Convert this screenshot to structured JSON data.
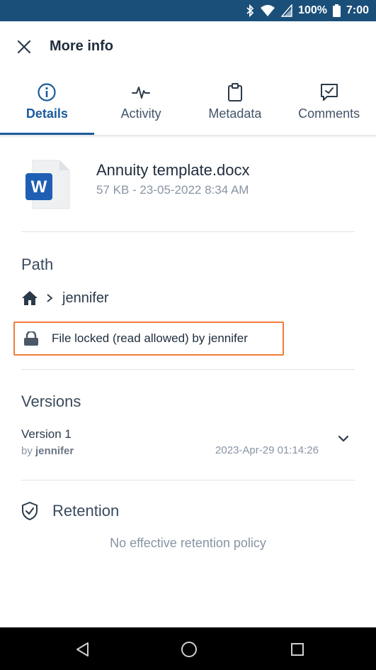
{
  "status_bar": {
    "battery": "100%",
    "time": "7:00"
  },
  "app_bar": {
    "title": "More info"
  },
  "tabs": [
    {
      "label": "Details",
      "icon": "info-icon",
      "active": true
    },
    {
      "label": "Activity",
      "icon": "activity-icon",
      "active": false
    },
    {
      "label": "Metadata",
      "icon": "clipboard-icon",
      "active": false
    },
    {
      "label": "Comments",
      "icon": "comment-check-icon",
      "active": false
    }
  ],
  "file": {
    "name": "Annuity template.docx",
    "meta": "57 KB - 23-05-2022 8:34 AM",
    "icon": "word-document-icon"
  },
  "path": {
    "title": "Path",
    "folder": "jennifer"
  },
  "lock": {
    "text": "File locked (read allowed) by jennifer"
  },
  "versions": {
    "title": "Versions",
    "items": [
      {
        "name": "Version 1",
        "by_prefix": "by",
        "by": "jennifer",
        "date": "2023-Apr-29 01:14:26"
      }
    ]
  },
  "retention": {
    "title": "Retention",
    "empty_text": "No effective retention policy"
  },
  "colors": {
    "status_bar": "#1a4f7a",
    "accent": "#1b5b9e",
    "highlight_border": "#f07c3a",
    "word_blue": "#1e5fb4"
  }
}
